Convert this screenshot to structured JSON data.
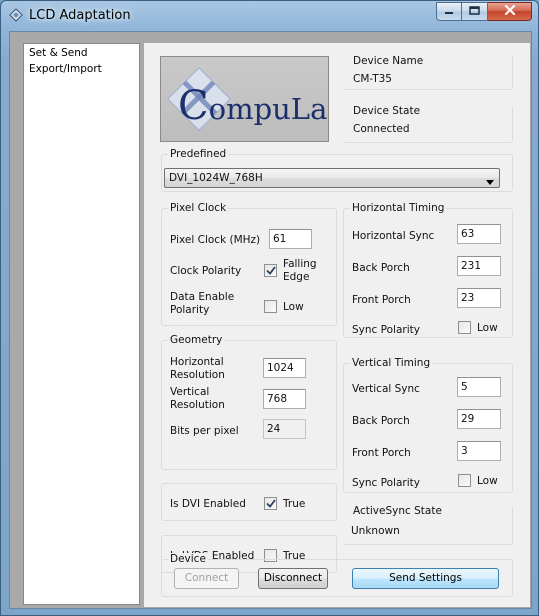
{
  "window": {
    "title": "LCD Adaptation",
    "icons": {
      "app": "diamond-app-icon",
      "minimize": "minimize-icon",
      "maximize": "maximize-icon",
      "close": "close-icon"
    }
  },
  "sidebar": {
    "items": [
      {
        "label": "Set & Send"
      },
      {
        "label": "Export/Import"
      }
    ]
  },
  "logo": {
    "text_first": "C",
    "text_rest": "ompuLab"
  },
  "device_name": {
    "title": "Device Name",
    "value": "CM-T35"
  },
  "device_state": {
    "title": "Device State",
    "value": "Connected"
  },
  "predefined": {
    "title": "Predefined",
    "selected": "DVI_1024W_768H"
  },
  "pixel_clock": {
    "title": "Pixel Clock",
    "clock_label": "Pixel Clock (MHz)",
    "clock_value": "61",
    "polarity_label": "Clock Polarity",
    "polarity_checked": true,
    "polarity_option": "Falling Edge",
    "de_polarity_label": "Data Enable Polarity",
    "de_polarity_checked": false,
    "de_polarity_option": "Low"
  },
  "geometry": {
    "title": "Geometry",
    "h_res_label": "Horizontal Resolution",
    "h_res_value": "1024",
    "v_res_label": "Vertical Resolution",
    "v_res_value": "768",
    "bpp_label": "Bits per pixel",
    "bpp_value": "24"
  },
  "dvi": {
    "label": "Is DVI Enabled",
    "checked": true,
    "option": "True"
  },
  "lvds": {
    "label": "Is LVDS Enabled",
    "checked": false,
    "option": "True"
  },
  "horizontal_timing": {
    "title": "Horizontal Timing",
    "sync_label": "Horizontal Sync",
    "sync_value": "63",
    "back_label": "Back Porch",
    "back_value": "231",
    "front_label": "Front Porch",
    "front_value": "23",
    "polarity_label": "Sync Polarity",
    "polarity_checked": false,
    "polarity_option": "Low"
  },
  "vertical_timing": {
    "title": "Vertical Timing",
    "sync_label": "Vertical Sync",
    "sync_value": "5",
    "back_label": "Back Porch",
    "back_value": "29",
    "front_label": "Front Porch",
    "front_value": "3",
    "polarity_label": "Sync Polarity",
    "polarity_checked": false,
    "polarity_option": "Low"
  },
  "activesync": {
    "title": "ActiveSync State",
    "value": "Unknown"
  },
  "device": {
    "title": "Device",
    "connect_label": "Connect",
    "connect_enabled": false,
    "disconnect_label": "Disconnect",
    "send_label": "Send Settings"
  },
  "colors": {
    "panel": "#f0f0f0",
    "workspace": "#a9a9a9",
    "logo_text": "#1c2f6b",
    "primary_button": "#bee6fd"
  }
}
